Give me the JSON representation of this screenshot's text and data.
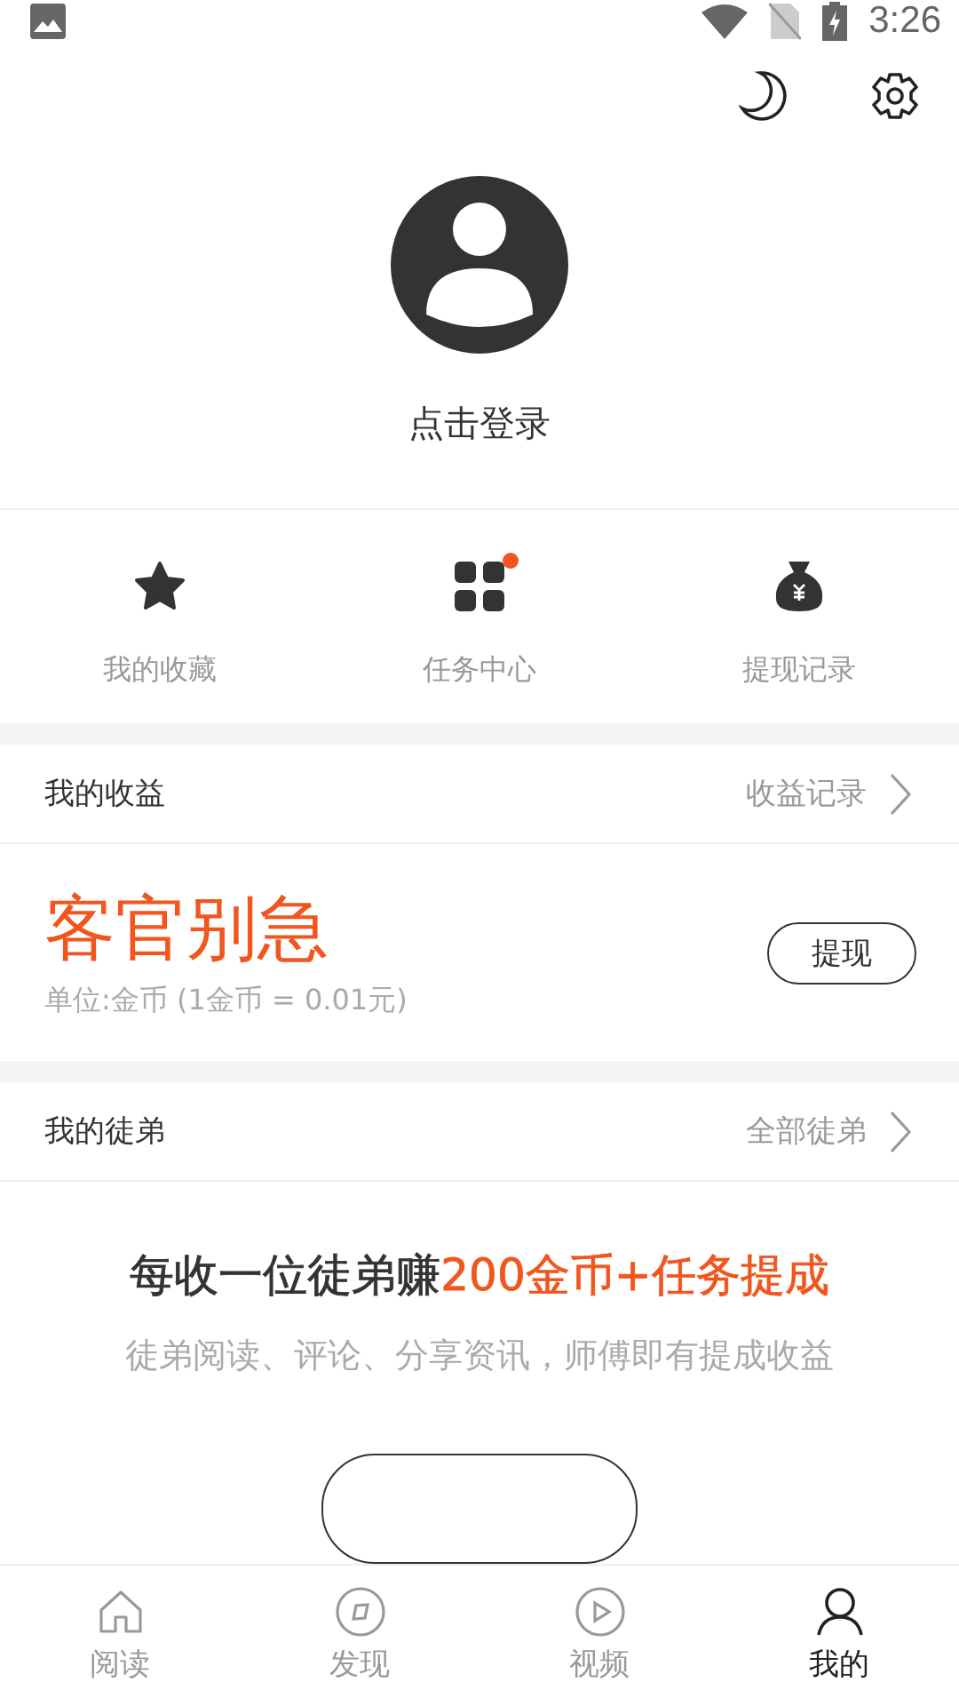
{
  "status_bar": {
    "time": "3:26"
  },
  "profile": {
    "login_label": "点击登录"
  },
  "shortcuts": [
    {
      "kind": "star",
      "label": "我的收藏",
      "badge": false
    },
    {
      "kind": "grid",
      "label": "任务中心",
      "badge": true
    },
    {
      "kind": "moneybag",
      "label": "提现记录",
      "badge": false
    }
  ],
  "earnings": {
    "title": "我的收益",
    "link": "收益记录",
    "amount": "客官别急",
    "unit_note": "单位:金币 (1金币 = 0.01元)",
    "button": "提现"
  },
  "apprentices": {
    "title": "我的徒弟",
    "link": "全部徒弟",
    "headline_prefix": "每收一位徒弟赚",
    "headline_highlight": "200金币+任务提成",
    "subtitle": "徒弟阅读、评论、分享资讯，师傅即有提成收益"
  },
  "bottom_nav": [
    {
      "kind": "home",
      "label": "阅读",
      "selected": false
    },
    {
      "kind": "compass",
      "label": "发现",
      "selected": false
    },
    {
      "kind": "play",
      "label": "视频",
      "selected": false
    },
    {
      "kind": "person",
      "label": "我的",
      "selected": true
    }
  ]
}
